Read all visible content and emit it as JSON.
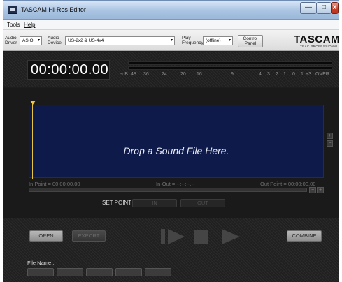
{
  "window": {
    "title": "TASCAM Hi-Res Editor",
    "controls": {
      "minimize": "—",
      "maximize": "□",
      "close": "x"
    }
  },
  "menu": [
    "Tools",
    "Help"
  ],
  "toolbar": {
    "audio_driver_label": [
      "Audio",
      "Driver"
    ],
    "audio_driver_value": "ASIO",
    "audio_device_label": [
      "Audio",
      "Device"
    ],
    "audio_device_value": "US-2x2 & US-4x4",
    "play_frequency_label": [
      "Play",
      "Frequency"
    ],
    "play_frequency_value": "(offline)",
    "control_panel_label": [
      "Control",
      "Panel"
    ],
    "logo_brand": "TASCAM",
    "logo_sub": "TEAC PROFESSIONAL"
  },
  "display": {
    "timecode": "00:00:00.00",
    "meter_scale": [
      "-dB",
      "48",
      "36",
      "24",
      "20",
      "16",
      "9",
      "4",
      "3",
      "2",
      "1",
      "0",
      "1",
      "+3",
      "OVER"
    ]
  },
  "editor": {
    "drop_text": "Drop a Sound File Here.",
    "in_point": "In Point = 00:00:00.00",
    "in_out": "In-Out = --:--:--.--",
    "out_point": "Out Point = 00:00:00.00",
    "zoom_in": "+",
    "zoom_out": "−",
    "scroll_minus": "−",
    "scroll_plus": "+",
    "set_point_label": "SET POINT",
    "in_button": "IN",
    "out_button": "OUT"
  },
  "bottom": {
    "open_button": "OPEN",
    "export_button": "EXPORT",
    "combine_button": "COMBINE",
    "file_name_label": "File Name :"
  },
  "colors": {
    "waveform_bg": "#0e1a4a",
    "playhead": "#e8c33c",
    "titlebar": "#aac4e2"
  }
}
